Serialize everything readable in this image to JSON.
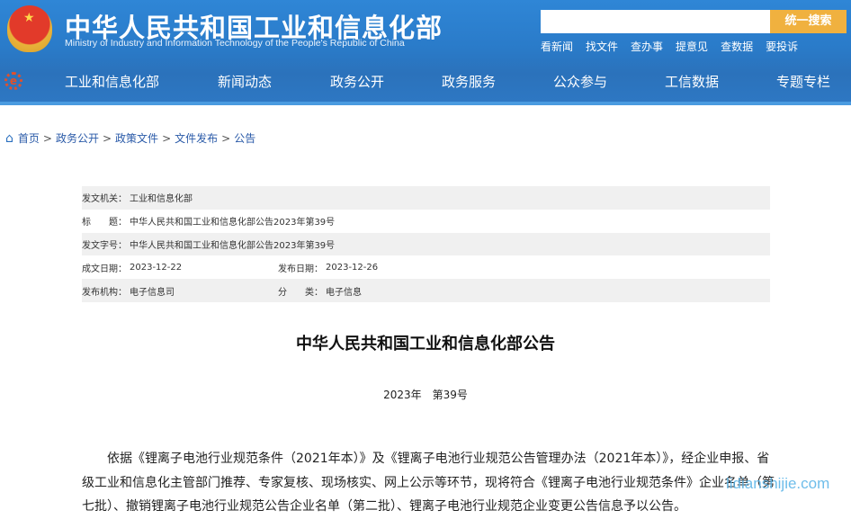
{
  "header": {
    "title": "中华人民共和国工业和信息化部",
    "subtitle": "Ministry of Industry and Information Technology of the People's Republic of China",
    "search_placeholder": "",
    "search_button": "统一搜索",
    "quick_links": [
      "看新闻",
      "找文件",
      "查办事",
      "提意见",
      "查数据",
      "要投诉"
    ]
  },
  "nav": [
    "工业和信息化部",
    "新闻动态",
    "政务公开",
    "政务服务",
    "公众参与",
    "工信数据",
    "专题专栏"
  ],
  "breadcrumb": [
    "首页",
    "政务公开",
    "政策文件",
    "文件发布",
    "公告"
  ],
  "meta": {
    "issuer_label": "发文机关：",
    "issuer": "工业和信息化部",
    "title_label": "标　　题：",
    "title": "中华人民共和国工业和信息化部公告2023年第39号",
    "doc_no_label": "发文字号：",
    "doc_no": "中华人民共和国工业和信息化部公告2023年第39号",
    "written_label": "成文日期：",
    "written": "2023-12-22",
    "published_label": "发布日期：",
    "published": "2023-12-26",
    "org_label": "发布机构：",
    "org": "电子信息司",
    "category_label": "分　　类：",
    "category": "电子信息"
  },
  "article": {
    "title": "中华人民共和国工业和信息化部公告",
    "number": "2023年　第39号",
    "body": "依据《锂离子电池行业规范条件（2021年本）》及《锂离子电池行业规范公告管理办法（2021年本）》，经企业申报、省级工业和信息化主管部门推荐、专家复核、现场核实、网上公示等环节，现将符合《锂离子电池行业规范条件》企业名单（第七批）、撤销锂离子电池行业规范公告企业名单（第二批）、锂离子电池行业规范企业变更公告信息予以公告。"
  },
  "watermark": "lidianshijie.com",
  "colors": {
    "header_blue": "#2a7bc9",
    "search_button": "#f0b13f",
    "link": "#2a5aa8"
  }
}
